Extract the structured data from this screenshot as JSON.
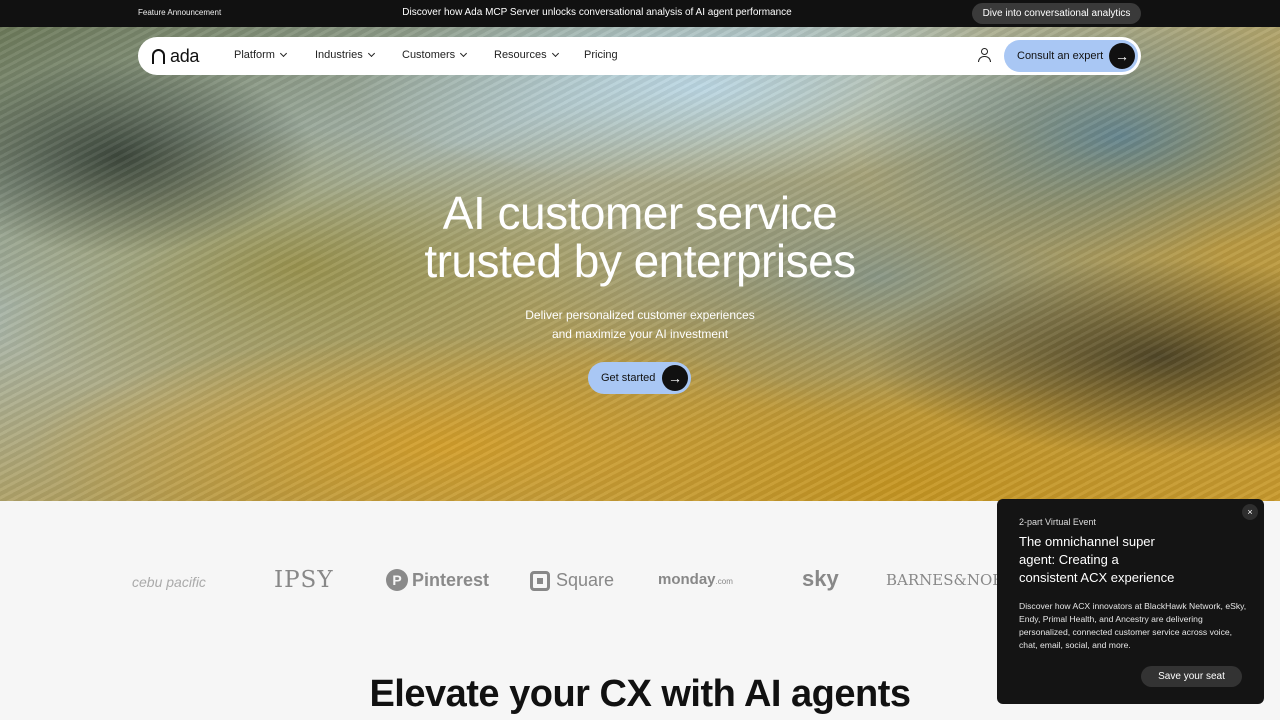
{
  "announcement": {
    "tag": "Feature Announcement",
    "message": "Discover how Ada MCP Server unlocks conversational analysis of AI agent performance",
    "cta": "Dive into conversational analytics"
  },
  "nav": {
    "logo": "ada",
    "items": [
      {
        "label": "Platform"
      },
      {
        "label": "Industries"
      },
      {
        "label": "Customers"
      },
      {
        "label": "Resources"
      },
      {
        "label": "Pricing"
      }
    ],
    "cta": "Consult an expert"
  },
  "hero": {
    "title_line1": "AI customer service",
    "title_line2": "trusted by enterprises",
    "subtitle_line1": "Deliver personalized customer experiences",
    "subtitle_line2": "and maximize your AI investment",
    "cta": "Get started"
  },
  "logos": {
    "cebu": "cebu pacific",
    "ipsy": "IPSY",
    "pinterest": "Pinterest",
    "square": "Square",
    "monday": "monday",
    "monday_suffix": ".com",
    "sky": "sky",
    "barnes": "BARNES&NOBLE"
  },
  "section": {
    "title": "Elevate your CX with AI agents"
  },
  "popup": {
    "eyebrow": "2-part Virtual Event",
    "title_line1": "The omnichannel super",
    "title_line2": "agent: Creating a",
    "title_line3": "consistent ACX experience",
    "description": "Discover how ACX innovators at BlackHawk Network, eSky, Endy, Primal Health, and Ancestry are delivering personalized, connected customer service across voice, chat, email, social, and more.",
    "cta": "Save your seat",
    "close": "×"
  },
  "colors": {
    "accent": "#a9c7f4",
    "dark": "#111111"
  }
}
